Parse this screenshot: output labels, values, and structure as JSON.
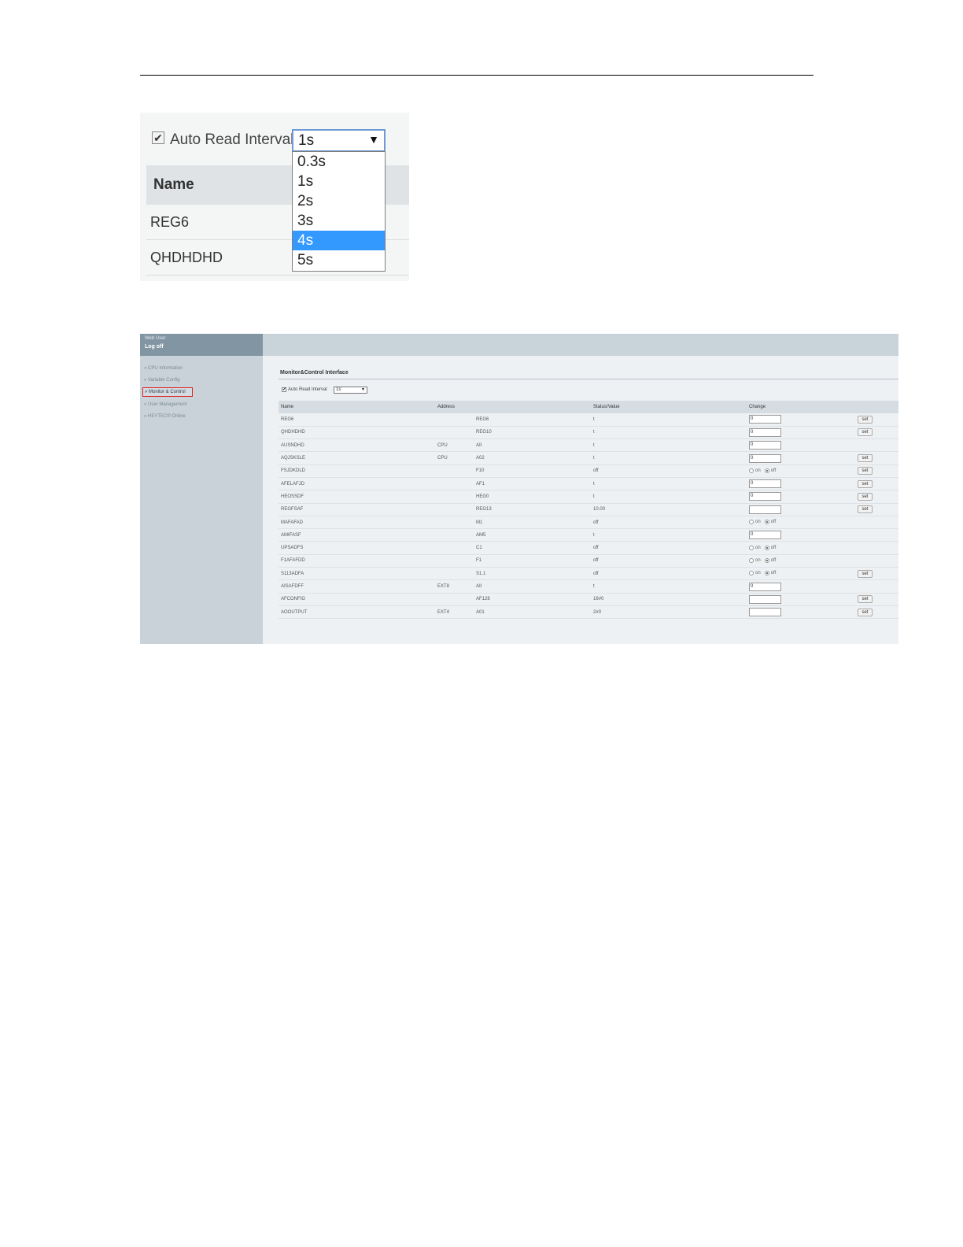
{
  "zoom": {
    "auto_read_label": "Auto Read Interval",
    "selected_interval": "1s",
    "arrow": "▼",
    "name_header": "Name",
    "rows": [
      "REG6",
      "QHDHDHD"
    ],
    "options": [
      "0.3s",
      "1s",
      "2s",
      "3s",
      "4s",
      "5s"
    ],
    "highlighted_option": "4s",
    "highlight_color": "#3399ff"
  },
  "app": {
    "user_line1": "Web User",
    "user_line2": "Log off",
    "nav": [
      "» CPU Information",
      "» Variable Config",
      "» Monitor & Control",
      "» User Management",
      "» HEYTEC® Online"
    ],
    "active_nav": "» Monitor & Control",
    "page_title": "Monitor&Control Interface",
    "auto_read_label": "Auto Read Interval",
    "auto_read_value": "1s",
    "arrow": "▼",
    "columns": [
      "Name",
      "Address",
      "Status/Value",
      "Change"
    ],
    "on_label": "on",
    "off_label": "off",
    "set_label": "set",
    "rows": [
      {
        "name": "REG6",
        "addr_a": "",
        "addr_b": "REG6",
        "value": "t",
        "change": "input",
        "input_value": "0",
        "set": true
      },
      {
        "name": "QHDHDHD",
        "addr_a": "",
        "addr_b": "REG10",
        "value": "t",
        "change": "input",
        "input_value": "0",
        "set": true
      },
      {
        "name": "AUSNDHD",
        "addr_a": "CPU",
        "addr_b": "AII",
        "value": "t",
        "change": "input",
        "input_value": "0",
        "set": false
      },
      {
        "name": "AQJSKSLE",
        "addr_a": "CPU",
        "addr_b": "A02",
        "value": "t",
        "change": "input",
        "input_value": "0",
        "set": true
      },
      {
        "name": "FSJDKDLD",
        "addr_a": "",
        "addr_b": "F10",
        "value": "off",
        "change": "radio",
        "set": true
      },
      {
        "name": "AFELAFJD",
        "addr_a": "",
        "addr_b": "AF1",
        "value": "t",
        "change": "input",
        "input_value": "0",
        "set": true
      },
      {
        "name": "HEOSSDF",
        "addr_a": "",
        "addr_b": "HEG0",
        "value": "t",
        "change": "input",
        "input_value": "0",
        "set": true
      },
      {
        "name": "REGFSAF",
        "addr_a": "",
        "addr_b": "REG13",
        "value": "10.00",
        "change": "input",
        "input_value": "",
        "set": true
      },
      {
        "name": "MAFAFAD",
        "addr_a": "",
        "addr_b": "M1",
        "value": "off",
        "change": "radio",
        "set": false
      },
      {
        "name": "AMIFASF",
        "addr_a": "",
        "addr_b": "AM5",
        "value": "t",
        "change": "input",
        "input_value": "0",
        "set": false
      },
      {
        "name": "UPSADFS",
        "addr_a": "",
        "addr_b": "C1",
        "value": "off",
        "change": "radio",
        "set": false
      },
      {
        "name": "F1AFAFDD",
        "addr_a": "",
        "addr_b": "F1",
        "value": "off",
        "change": "radio",
        "set": false
      },
      {
        "name": "S113ADFA",
        "addr_a": "",
        "addr_b": "S1.1",
        "value": "off",
        "change": "radio",
        "set": true
      },
      {
        "name": "AISAFDFF",
        "addr_a": "EXT8",
        "addr_b": "AII",
        "value": "t",
        "change": "input",
        "input_value": "0",
        "set": false
      },
      {
        "name": "AFCONFIG",
        "addr_a": "",
        "addr_b": "AF128",
        "value": "16#0",
        "change": "input",
        "input_value": "",
        "set": true
      },
      {
        "name": "AOOUTPUT",
        "addr_a": "EXT4",
        "addr_b": "A01",
        "value": "2#0",
        "change": "input",
        "input_value": "",
        "set": true
      }
    ]
  }
}
